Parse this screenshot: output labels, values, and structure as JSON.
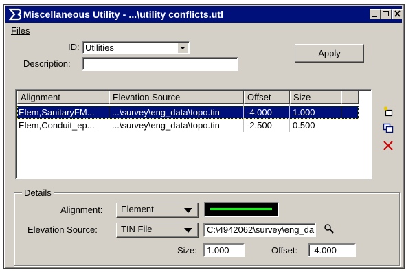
{
  "window": {
    "title": "Miscellaneous Utility - ...\\utility conflicts.utl",
    "app_icon": "bentley-b-icon",
    "controls": [
      "minimize-icon",
      "maximize-icon",
      "close-icon"
    ]
  },
  "menu": {
    "files": "Files"
  },
  "form": {
    "id_label": "ID:",
    "id_value": "Utilities",
    "description_label": "Description:",
    "description_value": "",
    "apply_label": "Apply"
  },
  "table": {
    "columns": [
      "Alignment",
      "Elevation Source",
      "Offset",
      "Size"
    ],
    "rows": [
      {
        "alignment": "Elem,SanitaryFM...",
        "source": "...\\survey\\eng_data\\topo.tin",
        "offset": "-4.000",
        "size": "1.000",
        "selected": true
      },
      {
        "alignment": "Elem,Conduit_ep...",
        "source": "...\\survey\\eng_data\\topo.tin",
        "offset": "-2.500",
        "size": "0.500",
        "selected": false
      }
    ]
  },
  "side_tools": [
    "add-item-icon",
    "copy-item-icon",
    "delete-item-icon"
  ],
  "details": {
    "title": "Details",
    "alignment_label": "Alignment:",
    "alignment_value": "Element",
    "line_color": "#00ff00",
    "elevation_label": "Elevation Source:",
    "elevation_value": "TIN File",
    "path_value": "C:\\4942062\\survey\\eng_da",
    "size_label": "Size:",
    "size_value": "1.000",
    "offset_label": "Offset:",
    "offset_value": "-4.000"
  },
  "colors": {
    "title_bar": "#00107b",
    "selection": "#00107b",
    "face": "#d4d0c8",
    "delete": "#cc0000"
  }
}
